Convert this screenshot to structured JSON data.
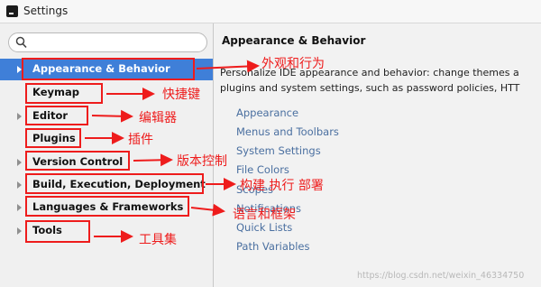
{
  "window": {
    "title": "Settings"
  },
  "search": {
    "placeholder": "",
    "value": ""
  },
  "sidebar": {
    "items": [
      {
        "label": "Appearance & Behavior",
        "expandable": true,
        "selected": true
      },
      {
        "label": "Keymap",
        "expandable": false,
        "selected": false
      },
      {
        "label": "Editor",
        "expandable": true,
        "selected": false
      },
      {
        "label": "Plugins",
        "expandable": false,
        "selected": false
      },
      {
        "label": "Version Control",
        "expandable": true,
        "selected": false
      },
      {
        "label": "Build, Execution, Deployment",
        "expandable": true,
        "selected": false
      },
      {
        "label": "Languages & Frameworks",
        "expandable": true,
        "selected": false
      },
      {
        "label": "Tools",
        "expandable": true,
        "selected": false
      }
    ]
  },
  "content": {
    "title": "Appearance & Behavior",
    "description_line1": "Personalize IDE appearance and behavior: change themes a",
    "description_line2": "plugins and system settings, such as password policies, HTT",
    "links": [
      "Appearance",
      "Menus and Toolbars",
      "System Settings",
      "File Colors",
      "Scopes",
      "Notifications",
      "Quick Lists",
      "Path Variables"
    ]
  },
  "annotations": [
    "外观和行为",
    "快捷键",
    "编辑器",
    "插件",
    "版本控制",
    "构建 执行 部署",
    "语言和框架",
    "工具集"
  ],
  "watermark": "https://blog.csdn.net/weixin_46334750",
  "colors": {
    "selection": "#3f7fd8",
    "annotation": "#ee1c1c",
    "link": "#4a6fa0"
  }
}
